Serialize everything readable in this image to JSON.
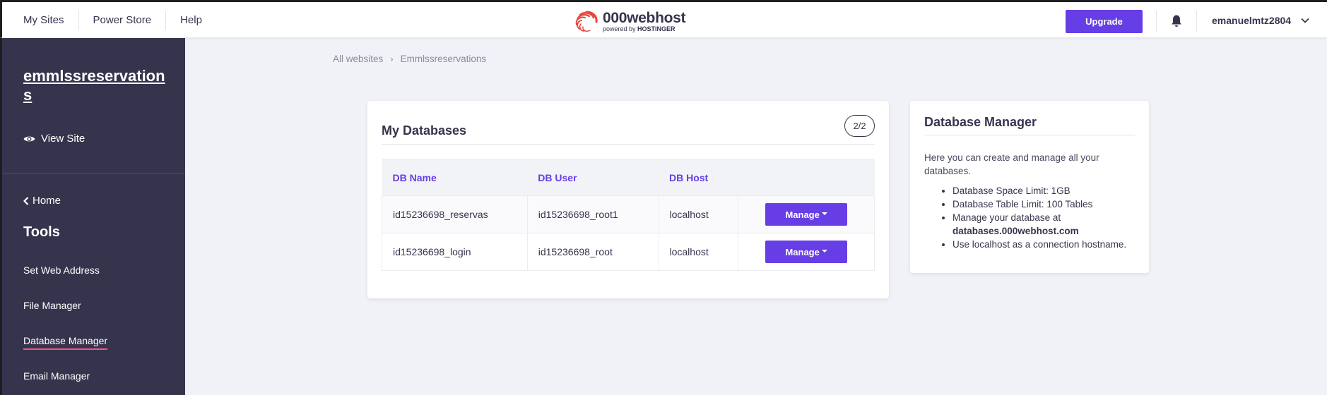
{
  "topnav": {
    "items": [
      "My Sites",
      "Power Store",
      "Help"
    ]
  },
  "logo": {
    "main": "000webhost",
    "sub_prefix": "powered by ",
    "sub_brand": "HOSTINGER"
  },
  "header": {
    "upgrade_label": "Upgrade",
    "username": "emanuelmtz2804"
  },
  "sidebar": {
    "site_name": "emmlssreservations",
    "view_site_label": "View Site",
    "home_label": "Home",
    "tools_title": "Tools",
    "items": [
      {
        "label": "Set Web Address"
      },
      {
        "label": "File Manager"
      },
      {
        "label": "Database Manager",
        "active": true
      },
      {
        "label": "Email Manager"
      }
    ]
  },
  "breadcrumb": {
    "root": "All websites",
    "current": "Emmlssreservations"
  },
  "databases": {
    "title": "My Databases",
    "count": "2/2",
    "columns": [
      "DB Name",
      "DB User",
      "DB Host",
      ""
    ],
    "rows": [
      {
        "name": "id15236698_reservas",
        "user": "id15236698_root1",
        "host": "localhost",
        "action": "Manage"
      },
      {
        "name": "id15236698_login",
        "user": "id15236698_root",
        "host": "localhost",
        "action": "Manage"
      }
    ]
  },
  "info": {
    "title": "Database Manager",
    "description": "Here you can create and manage all your databases.",
    "bullets": [
      "Database Space Limit: 1GB",
      "Database Table Limit: 100 Tables",
      "Manage your database at",
      "Use localhost as a connection hostname."
    ],
    "manage_url": "databases.000webhost.com"
  },
  "colors": {
    "accent": "#673de6",
    "sidebar_bg": "#36344d",
    "active_underline": "#fc5185",
    "page_bg": "#f0f2f7"
  }
}
